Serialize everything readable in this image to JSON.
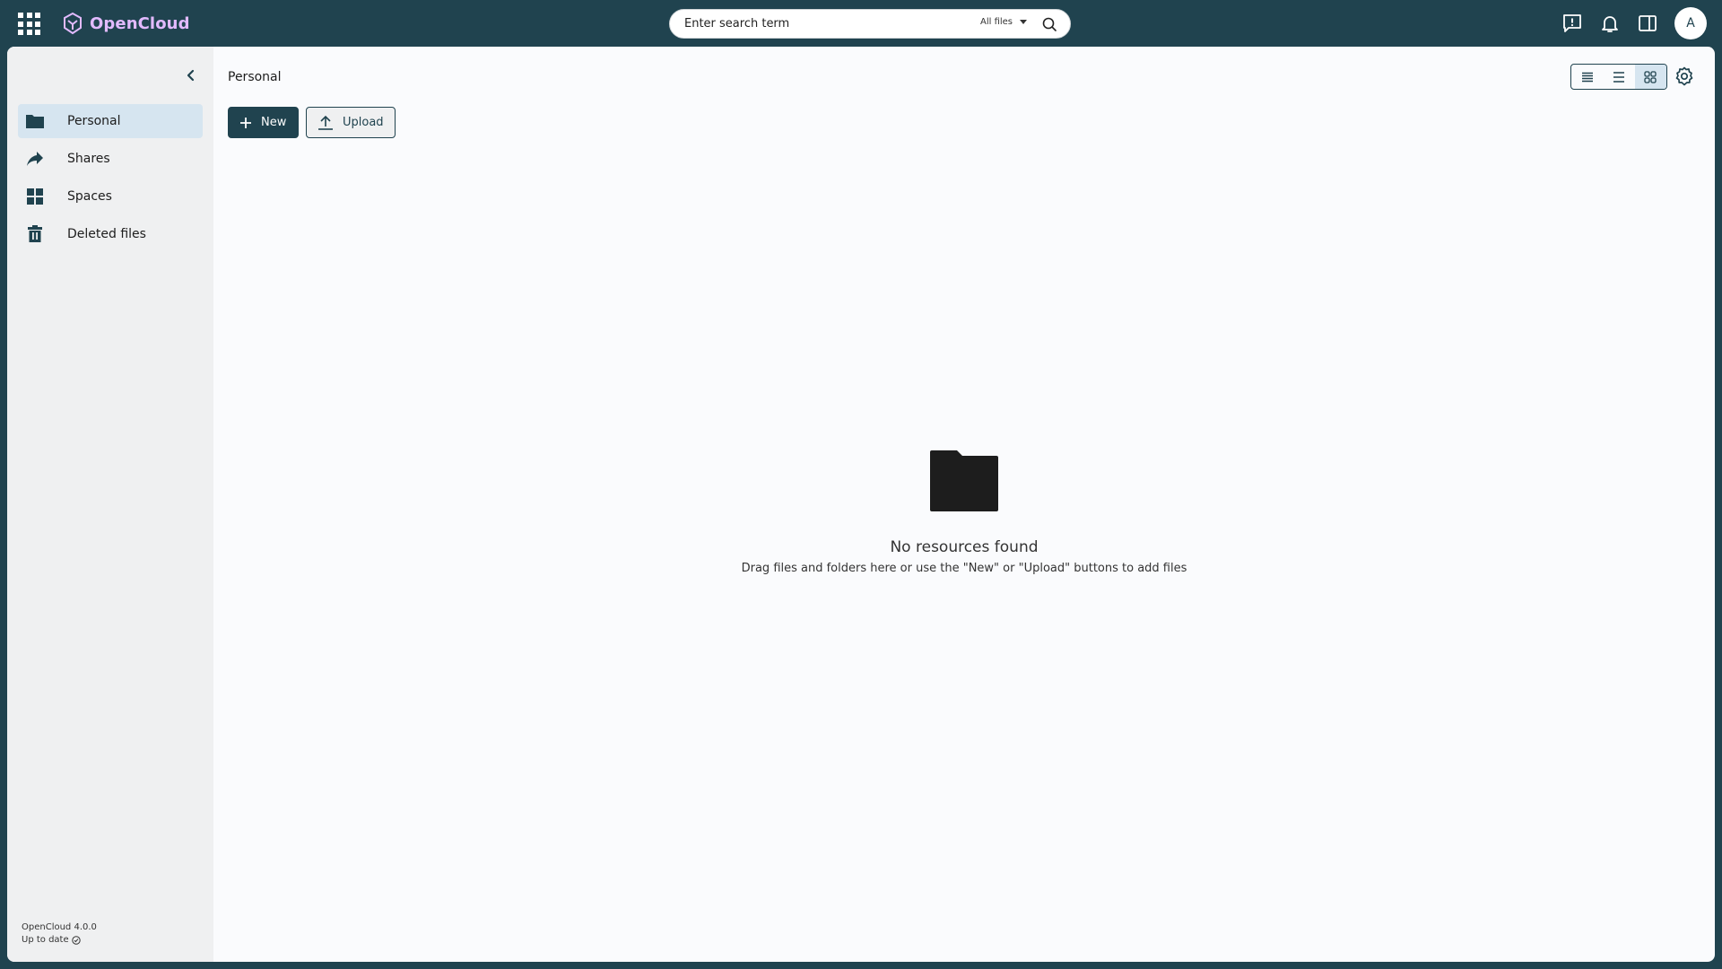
{
  "app": {
    "name": "OpenCloud"
  },
  "search": {
    "placeholder": "Enter search term",
    "scope": "All files"
  },
  "user": {
    "avatar_initial": "A"
  },
  "sidebar": {
    "items": [
      {
        "label": "Personal",
        "icon": "folder-icon",
        "active": true
      },
      {
        "label": "Shares",
        "icon": "share-icon",
        "active": false
      },
      {
        "label": "Spaces",
        "icon": "spaces-icon",
        "active": false
      },
      {
        "label": "Deleted files",
        "icon": "trash-icon",
        "active": false
      }
    ],
    "version": "OpenCloud 4.0.0",
    "status": "Up to date"
  },
  "main": {
    "breadcrumb": "Personal",
    "new_label": "New",
    "upload_label": "Upload",
    "view_modes": [
      "condensed-table",
      "table",
      "tiles"
    ],
    "active_view": "tiles"
  },
  "empty_state": {
    "title": "No resources found",
    "message": "Drag files and folders here or use the \"New\" or \"Upload\" buttons to add files"
  },
  "colors": {
    "topbar": "#20434f",
    "accent": "#20434f",
    "logo": "#e2baff",
    "sidebar_bg": "#eff0f1",
    "active_nav": "#d6e5f0",
    "content_bg": "#fafbfd"
  }
}
